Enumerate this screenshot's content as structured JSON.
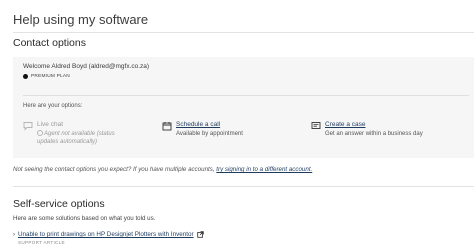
{
  "page": {
    "title": "Help using my software"
  },
  "contact": {
    "heading": "Contact options",
    "welcome": "Welcome Aldred Boyd",
    "email": "(aldred@mgfx.co.za)",
    "plan_badge": "PREMIUM PLAN",
    "options_label": "Here are your options:",
    "options": [
      {
        "icon": "chat-icon",
        "title": "Live chat",
        "subtitle": "Agent not available (status updates automatically)",
        "available": false
      },
      {
        "icon": "calendar-icon",
        "title": "Schedule a call",
        "subtitle": "Available by appointment",
        "available": true
      },
      {
        "icon": "case-icon",
        "title": "Create a case",
        "subtitle": "Get an answer within a business day",
        "available": true
      }
    ]
  },
  "note": {
    "text": "Not seeing the contact options you expect? If you have multiple accounts,",
    "link": "try signing in to a different account."
  },
  "self_service": {
    "heading": "Self-service options",
    "intro": "Here are some solutions based on what you told us.",
    "articles": [
      {
        "title": "Unable to print drawings on HP Designjet Plotters with Inventor",
        "type": "SUPPORT ARTICLE"
      }
    ]
  },
  "colors": {
    "link": "#1f3c5f",
    "card_bg": "#f6f6f6",
    "muted": "#9a9a9a"
  }
}
